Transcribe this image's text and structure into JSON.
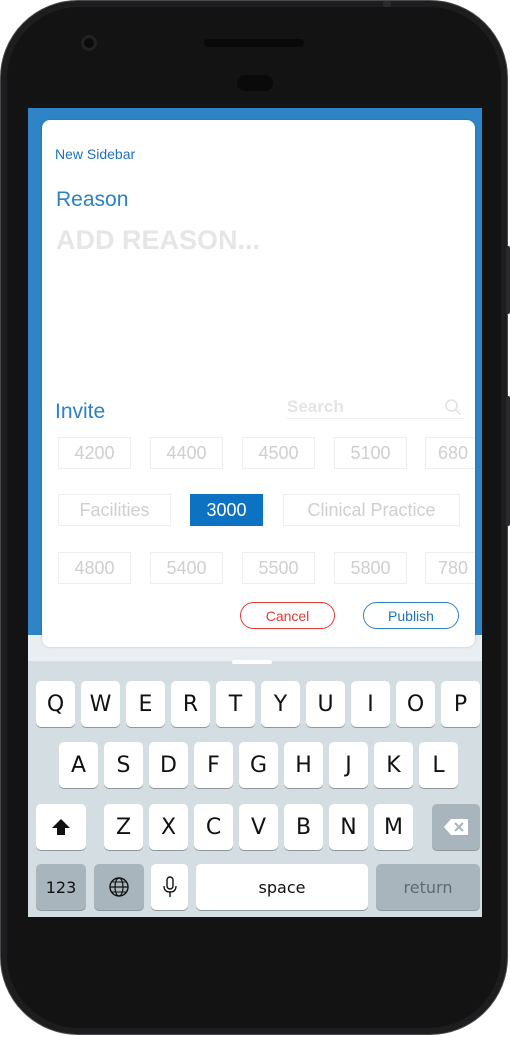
{
  "modal": {
    "title": "New Sidebar",
    "reason_label": "Reason",
    "reason_placeholder": "ADD REASON...",
    "invite_label": "Invite",
    "search_placeholder": "Search",
    "chip_rows": [
      [
        "4200",
        "4400",
        "4500",
        "5100",
        "680"
      ],
      [
        "Facilities",
        "3000",
        "Clinical Practice"
      ],
      [
        "4800",
        "5400",
        "5500",
        "5800",
        "780"
      ]
    ],
    "selected_chip": "3000",
    "cancel_label": "Cancel",
    "publish_label": "Publish"
  },
  "colors": {
    "accent": "#2a82c4",
    "selected_chip": "#0c72c1",
    "cancel": "#e53935",
    "app_background": "#2e84c4",
    "keyboard": "#d4dee2"
  },
  "keyboard": {
    "row1": [
      "Q",
      "W",
      "E",
      "R",
      "T",
      "Y",
      "U",
      "I",
      "O",
      "P"
    ],
    "row2": [
      "A",
      "S",
      "D",
      "F",
      "G",
      "H",
      "J",
      "K",
      "L"
    ],
    "row3": [
      "Z",
      "X",
      "C",
      "V",
      "B",
      "N",
      "M"
    ],
    "numbers_label": "123",
    "space_label": "space",
    "return_label": "return",
    "icons": [
      "shift-icon",
      "backspace-icon",
      "globe-icon",
      "microphone-icon"
    ]
  }
}
